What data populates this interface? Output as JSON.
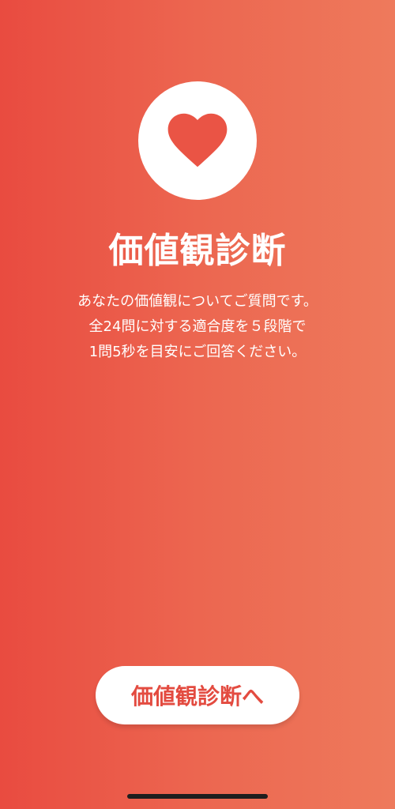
{
  "colors": {
    "gradient_start": "#E94B40",
    "gradient_end": "#EE7A5C",
    "accent": "#E34B40",
    "white": "#FFFFFF"
  },
  "hero": {
    "icon": "heart-icon",
    "title": "価値観診断"
  },
  "description": {
    "lines": [
      "あなたの価値観についてご質問です。",
      "全24問に対する適合度を５段階で",
      "1問5秒を目安にご回答ください。"
    ]
  },
  "cta": {
    "label": "価値観診断へ"
  }
}
